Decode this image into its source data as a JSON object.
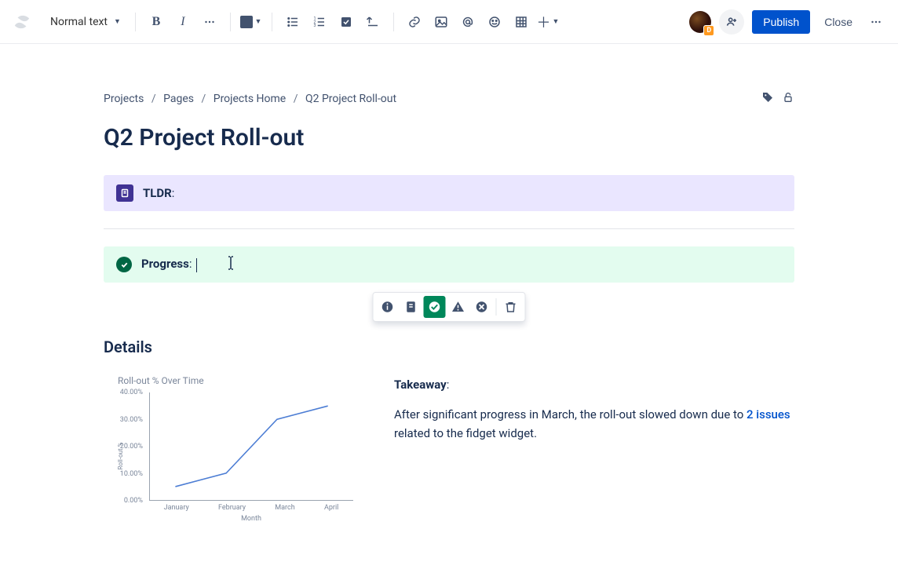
{
  "toolbar": {
    "text_style": "Normal text",
    "publish_label": "Publish",
    "close_label": "Close",
    "avatar_badge": "D"
  },
  "breadcrumbs": [
    "Projects",
    "Pages",
    "Projects Home",
    "Q2 Project Roll-out"
  ],
  "page_title": "Q2 Project Roll-out",
  "panels": {
    "tldr_label": "TLDR",
    "progress_label": "Progress"
  },
  "details_heading": "Details",
  "takeaway": {
    "heading": "Takeaway",
    "body_before": "After significant progress in March, the roll-out slowed down due to ",
    "link_text": "2 issues",
    "body_after": " related to the fidget widget."
  },
  "chart_data": {
    "type": "line",
    "title": "Roll-out % Over Time",
    "xlabel": "Month",
    "ylabel": "Roll-out %",
    "categories": [
      "January",
      "February",
      "March",
      "April"
    ],
    "values": [
      5,
      10,
      30,
      35
    ],
    "ylim": [
      0,
      40
    ],
    "yticks": [
      0,
      10,
      20,
      30,
      40
    ],
    "ytick_labels": [
      "0.00%",
      "10.00%",
      "20.00%",
      "30.00%",
      "40.00%"
    ]
  }
}
